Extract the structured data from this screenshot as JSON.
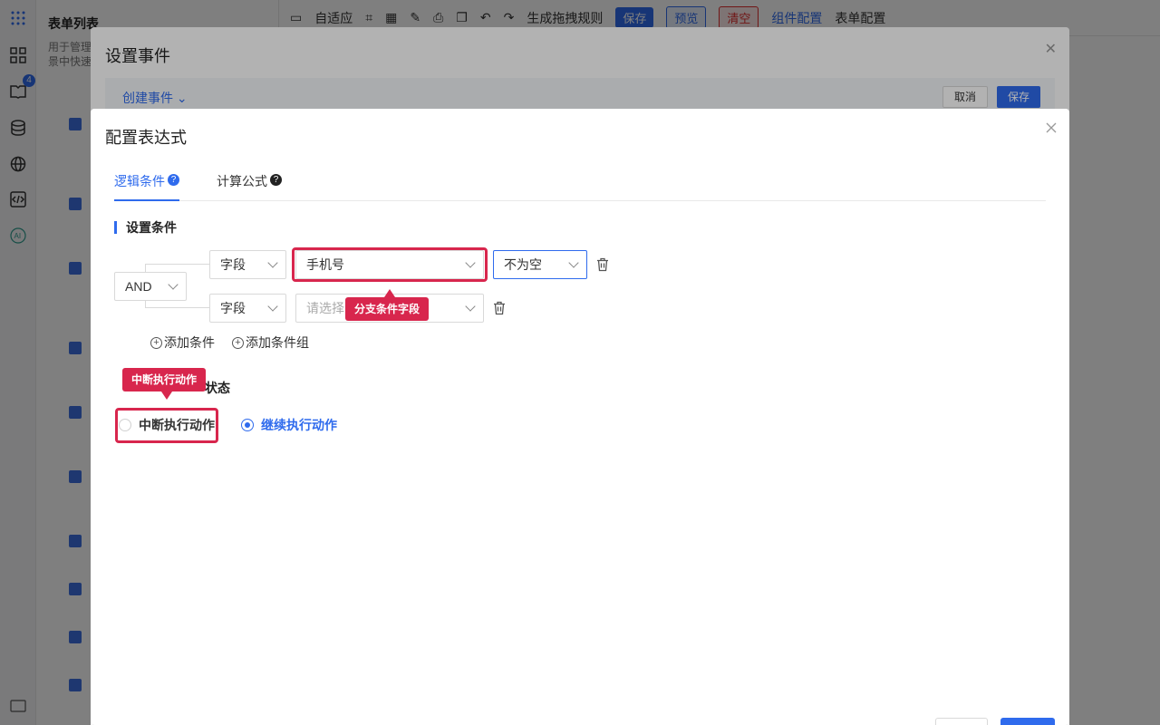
{
  "background": {
    "sidebar_title": "表单列表",
    "sidebar_desc_line1": "用于管理",
    "sidebar_desc_line2": "景中快速",
    "toolbar": {
      "adaptive": "自适应",
      "generate_rules": "生成拖拽规则",
      "save": "保存",
      "preview": "预览",
      "clear": "清空",
      "component_config": "组件配置",
      "form_config": "表单配置"
    },
    "badge_count": "4"
  },
  "event_dialog": {
    "title": "设置事件",
    "create_event": "创建事件",
    "cancel": "取消",
    "save": "保存"
  },
  "expr_dialog": {
    "title": "配置表达式",
    "tabs": [
      {
        "label": "逻辑条件",
        "active": true
      },
      {
        "label": "计算公式",
        "active": false
      }
    ],
    "condition_section": "设置条件",
    "logic_operator": "AND",
    "conditions": [
      {
        "type": "字段",
        "field": "手机号",
        "operator": "不为空"
      },
      {
        "type": "字段",
        "field_placeholder": "请选择"
      }
    ],
    "add_condition": "添加条件",
    "add_condition_group": "添加条件组",
    "status_section_suffix": "状态",
    "radio_options": [
      {
        "label": "中断执行动作",
        "checked": false
      },
      {
        "label": "继续执行动作",
        "checked": true
      }
    ]
  },
  "annotations": {
    "branch_field": "分支条件字段",
    "interrupt_action": "中断执行动作"
  },
  "colors": {
    "primary": "#2f6bed",
    "annotation": "#d8264d"
  }
}
